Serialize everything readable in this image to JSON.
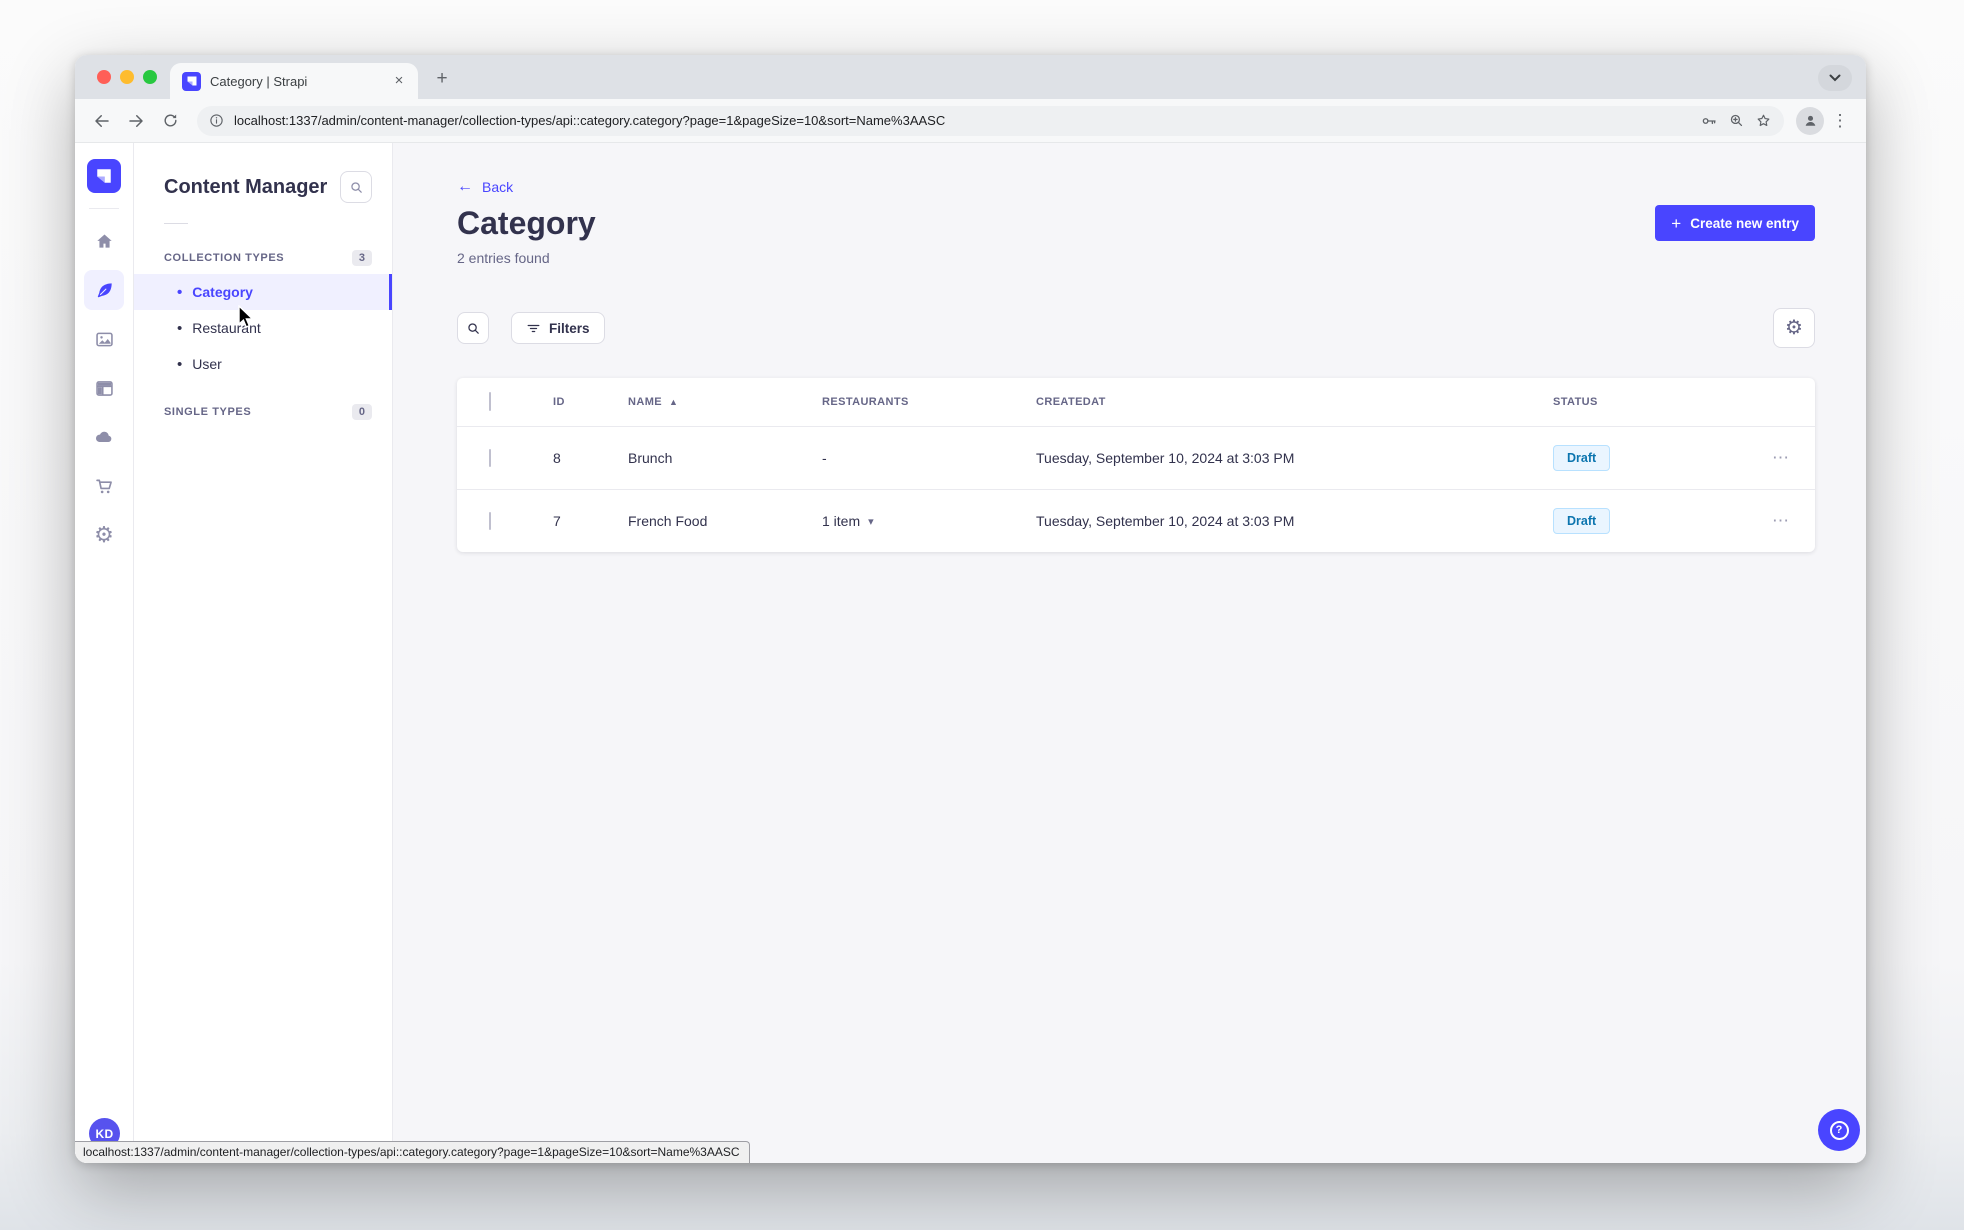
{
  "browser": {
    "tab_title": "Category | Strapi",
    "url": "localhost:1337/admin/content-manager/collection-types/api::category.category?page=1&pageSize=10&sort=Name%3AASC",
    "status_url": "localhost:1337/admin/content-manager/collection-types/api::category.category?page=1&pageSize=10&sort=Name%3AASC"
  },
  "icons": {
    "close_tab": "×",
    "new_tab": "+",
    "more_vertical": "⋮",
    "more_horizontal": "⋯",
    "back_arrow": "←",
    "sort_ascending": "▲",
    "caret_down": "▾",
    "bullet": "•",
    "plus": "+",
    "help": "?",
    "gear": "⚙"
  },
  "sidebar": {
    "nav_items": [
      "home",
      "content-manager",
      "media-library",
      "content-type-builder",
      "cloud",
      "marketplace",
      "settings"
    ],
    "active_item": "content-manager",
    "avatar_initials": "KD"
  },
  "subnav": {
    "title": "Content Manager",
    "collection_types": {
      "label": "COLLECTION TYPES",
      "count": "3"
    },
    "single_types": {
      "label": "SINGLE TYPES",
      "count": "0"
    },
    "items": [
      {
        "label": "Category",
        "active": true
      },
      {
        "label": "Restaurant",
        "active": false
      },
      {
        "label": "User",
        "active": false
      }
    ]
  },
  "main": {
    "back_label": "Back",
    "title": "Category",
    "subtitle": "2 entries found",
    "create_label": "Create new entry",
    "filters_label": "Filters",
    "table": {
      "columns": [
        "ID",
        "NAME",
        "RESTAURANTS",
        "CREATEDAT",
        "STATUS"
      ],
      "sorted_column": "NAME",
      "sort_direction": "ascending",
      "rows": [
        {
          "id": "8",
          "name": "Brunch",
          "restaurants": "-",
          "created_at": "Tuesday, September 10, 2024 at 3:03 PM",
          "status": "Draft"
        },
        {
          "id": "7",
          "name": "French Food",
          "restaurants": "1 item",
          "created_at": "Tuesday, September 10, 2024 at 3:03 PM",
          "status": "Draft"
        }
      ]
    }
  },
  "colors": {
    "primary": "#4945ff",
    "primary_light_bg": "#f0f0ff",
    "draft_bg": "#eaf5ff",
    "draft_border": "#b8e1ff",
    "draft_text": "#0c75af",
    "neutral_text": "#32324d",
    "muted_text": "#666687",
    "traffic_red": "#ff5f57",
    "traffic_yellow": "#febc2e",
    "traffic_green": "#28c840"
  }
}
